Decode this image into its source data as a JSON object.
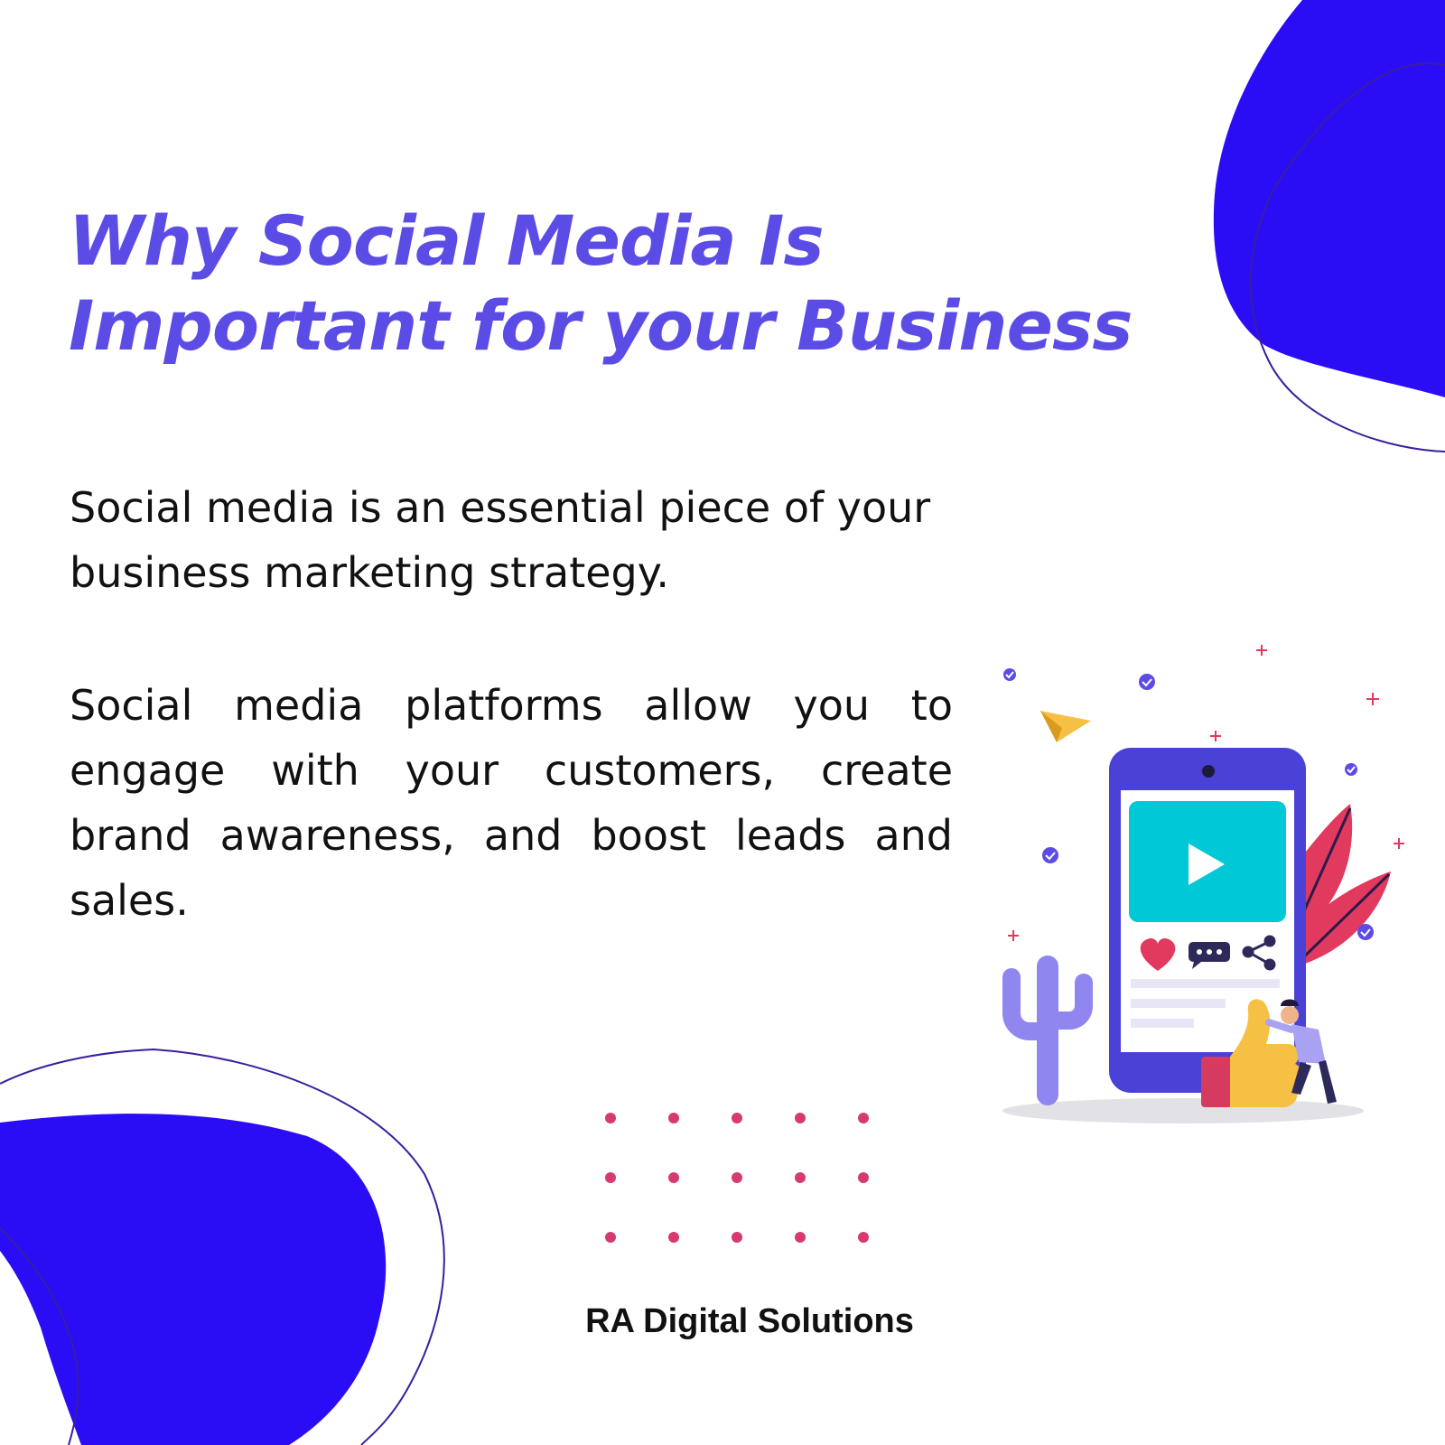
{
  "title": {
    "line1": "Why Social Media Is",
    "line2": "Important for your Business"
  },
  "paragraphs": [
    "Social media is an essential piece of your business marketing strategy.",
    "Social media platforms allow you to engage with your customers, create brand awareness, and boost leads and sales."
  ],
  "footer": {
    "brand": "RA Digital Solutions"
  },
  "illustration": {
    "icons": [
      "phone-icon",
      "play-icon",
      "heart-icon",
      "chat-icon",
      "share-icon",
      "thumbs-up-icon",
      "paper-plane-icon",
      "cactus-icon",
      "leaf-icon",
      "person-icon",
      "check-icon",
      "sparkle-icon"
    ]
  },
  "colors": {
    "title": "#5b4ce6",
    "blob": "#2b0df5",
    "outline": "#3a1e9e",
    "dot": "#d63a6e",
    "phone": "#4a42d6",
    "video": "#00c8d7",
    "leaf": "#e23a5e",
    "thumb": "#f5c043"
  }
}
